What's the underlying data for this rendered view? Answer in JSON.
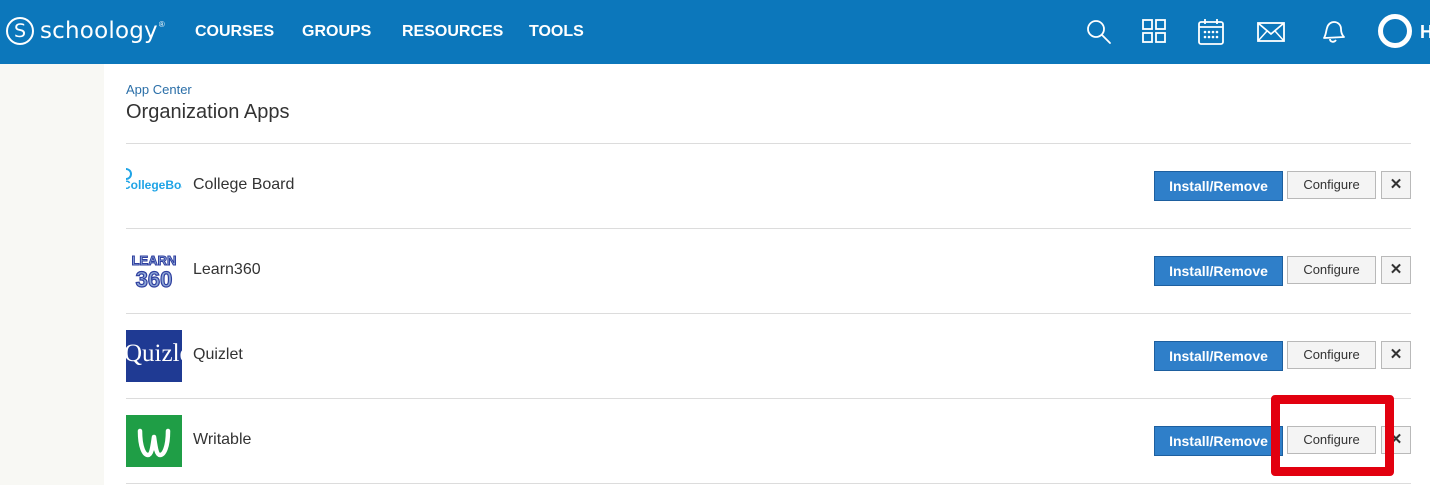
{
  "brand": {
    "logo_letter": "S",
    "name": "schoology",
    "tm": "®",
    "color": "#0c77bb"
  },
  "nav": {
    "items": [
      "COURSES",
      "GROUPS",
      "RESOURCES",
      "TOOLS"
    ],
    "icons": [
      "search-icon",
      "apps-grid-icon",
      "calendar-icon",
      "mail-icon",
      "notifications-icon"
    ],
    "user_initial": "H"
  },
  "breadcrumb": "App Center",
  "page_title": "Organization Apps",
  "buttons": {
    "install": "Install/Remove",
    "configure": "Configure",
    "remove": "✕"
  },
  "apps": [
    {
      "name": "College Board",
      "logo_text": "CollegeBoard",
      "logo_color": "#1fa4e6"
    },
    {
      "name": "Learn360",
      "logo_text_top": "LEARN",
      "logo_text_bottom": "360",
      "logo_color": "#2f3f9f"
    },
    {
      "name": "Quizlet",
      "logo_text": "Quizlet",
      "logo_color": "#1f3a93"
    },
    {
      "name": "Writable",
      "logo_text": "W",
      "logo_color": "#1f9e46"
    }
  ],
  "highlight_color": "#e2000f"
}
